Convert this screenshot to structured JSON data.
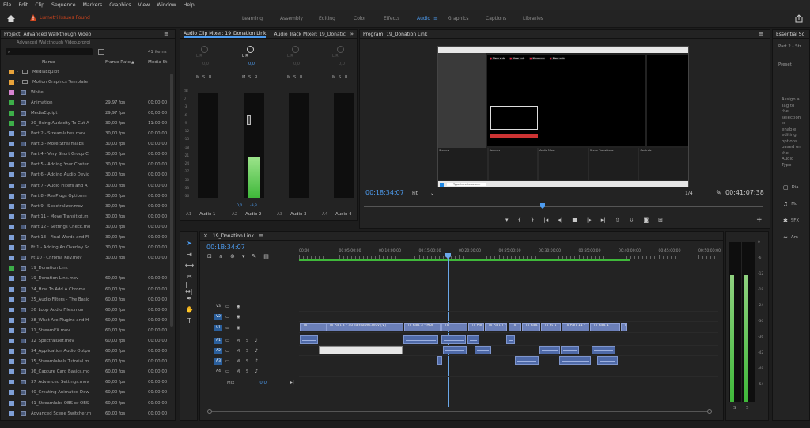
{
  "menu": [
    "File",
    "Edit",
    "Clip",
    "Sequence",
    "Markers",
    "Graphics",
    "View",
    "Window",
    "Help"
  ],
  "alert": "Lumetri Issues Found",
  "workspaces": {
    "items": [
      "Learning",
      "Assembly",
      "Editing",
      "Color",
      "Effects",
      "Audio",
      "Graphics",
      "Captions",
      "Libraries"
    ],
    "active": "Audio"
  },
  "project": {
    "tab": "Project: Advanced Walkthough Video",
    "file": "Advanced Walkthough Video.prproj",
    "count": "41 items",
    "col_name": "Name",
    "col_fr": "Frame Rate",
    "col_ms": "Media St",
    "rows": [
      {
        "n": "MediaEquipt",
        "fr": "",
        "ms": "",
        "c": "#e8a33b",
        "t": "folder"
      },
      {
        "n": "Motion Graphics Template",
        "fr": "",
        "ms": "",
        "c": "#e8a33b",
        "t": "folder"
      },
      {
        "n": "White",
        "fr": "",
        "ms": "",
        "c": "#d884d2",
        "t": "img"
      },
      {
        "n": "Animation",
        "fr": "29,97 fps",
        "ms": "00;00;00",
        "c": "#3dae49",
        "t": "img"
      },
      {
        "n": "MediaEquipt",
        "fr": "29,97 fps",
        "ms": "00;00;00",
        "c": "#3dae49",
        "t": "img"
      },
      {
        "n": "20_Using Audacity To Cut A",
        "fr": "30,00 fps",
        "ms": "11:00:00",
        "c": "#3dae49",
        "t": "img"
      },
      {
        "n": "Part 2 - Streamlabes.mov",
        "fr": "30,00 fps",
        "ms": "00:00:00",
        "c": "#7fa0d8",
        "t": "img"
      },
      {
        "n": "Part 3 - More Streamlabs",
        "fr": "30,00 fps",
        "ms": "00:00:00",
        "c": "#7fa0d8",
        "t": "img"
      },
      {
        "n": "Part 4 - Very Short Group C",
        "fr": "30,00 fps",
        "ms": "00:00:00",
        "c": "#7fa0d8",
        "t": "img"
      },
      {
        "n": "Part 5 - Adding Your Conten",
        "fr": "30,00 fps",
        "ms": "00:00:00",
        "c": "#7fa0d8",
        "t": "img"
      },
      {
        "n": "Part 6 - Adding Audio Devic",
        "fr": "30,00 fps",
        "ms": "00:00:00",
        "c": "#7fa0d8",
        "t": "img"
      },
      {
        "n": "Part 7 - Audio Filters and A",
        "fr": "30,00 fps",
        "ms": "00:00:00",
        "c": "#7fa0d8",
        "t": "img"
      },
      {
        "n": "Part 8 - ReaPlugs Optionm",
        "fr": "30,00 fps",
        "ms": "00:00:00",
        "c": "#7fa0d8",
        "t": "img"
      },
      {
        "n": "Part 9 - Spectralizer.mov",
        "fr": "30,00 fps",
        "ms": "00:00:00",
        "c": "#7fa0d8",
        "t": "img"
      },
      {
        "n": "Part 11 - Move Transitiot.m",
        "fr": "30,00 fps",
        "ms": "00:00:00",
        "c": "#7fa0d8",
        "t": "img"
      },
      {
        "n": "Part 12 - Settings Check.mo",
        "fr": "30,00 fps",
        "ms": "00:00:00",
        "c": "#7fa0d8",
        "t": "img"
      },
      {
        "n": "Part 13 - Final Words and Fl",
        "fr": "30,00 fps",
        "ms": "00:00:00",
        "c": "#7fa0d8",
        "t": "img"
      },
      {
        "n": "Pt 1 - Adding An Overlay Sc",
        "fr": "30,00 fps",
        "ms": "00:00:00",
        "c": "#7fa0d8",
        "t": "img"
      },
      {
        "n": "Pt 10 - Chroma Key.mov",
        "fr": "30,00 fps",
        "ms": "00:00:00",
        "c": "#7fa0d8",
        "t": "img"
      },
      {
        "n": "19_Donation Link",
        "fr": "",
        "ms": "",
        "c": "#3dae49",
        "t": "img"
      },
      {
        "n": "19_Donation Link.mov",
        "fr": "60,00 fps",
        "ms": "00:00:00",
        "c": "#7fa0d8",
        "t": "img"
      },
      {
        "n": "24_How To Add A Chroma",
        "fr": "60,00 fps",
        "ms": "00:00:00",
        "c": "#7fa0d8",
        "t": "img"
      },
      {
        "n": "25_Audio Filters - The Basic",
        "fr": "60,00 fps",
        "ms": "00:00:00",
        "c": "#7fa0d8",
        "t": "img"
      },
      {
        "n": "26_Loop Audio Files.mov",
        "fr": "60,00 fps",
        "ms": "00:00:00",
        "c": "#7fa0d8",
        "t": "img"
      },
      {
        "n": "28_What Are Plugins and H",
        "fr": "60,00 fps",
        "ms": "00:00:00",
        "c": "#7fa0d8",
        "t": "img"
      },
      {
        "n": "31_StreamFX.mov",
        "fr": "60,00 fps",
        "ms": "00:00:00",
        "c": "#7fa0d8",
        "t": "img"
      },
      {
        "n": "32_Spectralizer.mov",
        "fr": "60,00 fps",
        "ms": "00:00:00",
        "c": "#7fa0d8",
        "t": "img"
      },
      {
        "n": "34_Application Audio Outpu",
        "fr": "60,00 fps",
        "ms": "00:00:00",
        "c": "#7fa0d8",
        "t": "img"
      },
      {
        "n": "35_Streamlabels Tutorial.m",
        "fr": "60,00 fps",
        "ms": "00:00:00",
        "c": "#7fa0d8",
        "t": "img"
      },
      {
        "n": "36_Capture Card Basics.mo",
        "fr": "60,00 fps",
        "ms": "00:00:00",
        "c": "#7fa0d8",
        "t": "img"
      },
      {
        "n": "37_Advanced Settings.mov",
        "fr": "60,00 fps",
        "ms": "00:00:00",
        "c": "#7fa0d8",
        "t": "img"
      },
      {
        "n": "40_Creating Animated Dow",
        "fr": "60,00 fps",
        "ms": "00:00:00",
        "c": "#7fa0d8",
        "t": "img"
      },
      {
        "n": "41_Streamlabs OBS or OBS",
        "fr": "60,00 fps",
        "ms": "00:00:00",
        "c": "#7fa0d8",
        "t": "img"
      },
      {
        "n": "Advanced Scene Switcher.m",
        "fr": "60,00 fps",
        "ms": "00:00:00",
        "c": "#7fa0d8",
        "t": "img"
      }
    ]
  },
  "mixer": {
    "tab1": "Audio Clip Mixer: 19_Donation Link",
    "tab2": "Audio Track Mixer: 19_Donatic",
    "chan": [
      {
        "t": "A1",
        "n": "Audio 1",
        "pan": "0,0"
      },
      {
        "t": "A2",
        "n": "Audio 2",
        "pan": "0,0"
      },
      {
        "t": "A3",
        "n": "Audio 3",
        "pan": "0,0"
      },
      {
        "t": "A4",
        "n": "Audio 4",
        "pan": "0,0"
      }
    ],
    "pan_label": "L",
    "pan_r": "R",
    "db_scale": [
      "dB",
      "0",
      "-3",
      "-6",
      "-9",
      "-12",
      "-15",
      "-18",
      "-21",
      "-24",
      "-27",
      "-30",
      "-33",
      "-36"
    ],
    "gain_a": "0,0",
    "gain_b": "-9,3",
    "level": 0.38,
    "msr": [
      "M",
      "S",
      "R"
    ]
  },
  "program": {
    "tab": "Program: 19_Donation Link",
    "tc": "00:18:34:07",
    "fit": "Fit",
    "ratio": "1/4",
    "dur": "00:41:07:38",
    "tc_in": "00:18:34:07"
  },
  "screen": {
    "alerts": [
      "New sub",
      "New sub",
      "New sub",
      "New sub"
    ],
    "panels": [
      "Scenes",
      "Sources",
      "Audio Mixer",
      "Scene Transitions",
      "Controls"
    ],
    "taskbar": "Type here to search"
  },
  "timeline": {
    "tab": "19_Donation Link",
    "tc": "00:18:34:07",
    "ruler": [
      "00:00",
      "00:05:00:00",
      "00:10:00:00",
      "00:15:00:00",
      "00:20:00:00",
      "00:25:00:00",
      "00:30:00:00",
      "00:35:00:00",
      "00:40:00:00",
      "00:45:00:00",
      "00:50:00:00"
    ],
    "tracks": [
      {
        "n": "V3",
        "on": false
      },
      {
        "n": "V2",
        "on": true
      },
      {
        "n": "V1",
        "on": true
      },
      {
        "n": "A1",
        "on": true
      },
      {
        "n": "A2",
        "on": true
      },
      {
        "n": "A3",
        "on": true
      },
      {
        "n": "A4",
        "on": false
      }
    ],
    "mix": "Mix",
    "mix_val": "0,0",
    "vclips": [
      "Part 2 - Streamlabes.mov [V]",
      "Part 3 - Mor",
      "Part 5",
      "Part 7 -",
      "Part 9",
      "Pt 1",
      "Part 11 -",
      "Part 1"
    ]
  },
  "meter_r": {
    "scale": [
      "0",
      "-6",
      "-12",
      "-18",
      "-24",
      "-30",
      "-36",
      "-42",
      "-48",
      "-54"
    ],
    "level_l": 0.79,
    "level_r": 0.79,
    "s1": "S",
    "s2": "S"
  },
  "essential": {
    "tab": "Essential Sc",
    "item": "Part 2 - Str...",
    "preset": "Preset",
    "desc": [
      "Assign a",
      "Tag to",
      "the",
      "selection",
      "to",
      "enable",
      "editing",
      "options",
      "based on",
      "the",
      "Audio",
      "Type"
    ],
    "types": [
      "Dia",
      "Mu",
      "SFX",
      "Am"
    ]
  },
  "colors": {
    "accent": "#4d9cf0",
    "alert": "#d0441c",
    "meter": "#3fb83a",
    "playhead": "#6aa7e8",
    "video": "#6b7fb8",
    "audio": "#4f6aa8"
  }
}
